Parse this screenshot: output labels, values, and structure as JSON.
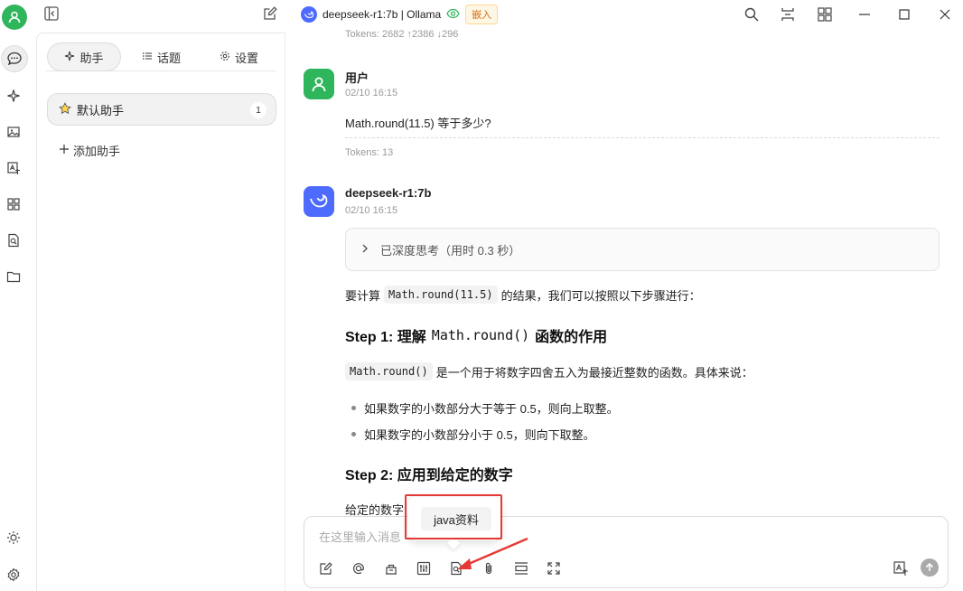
{
  "topbar": {
    "model_name": "deepseek-r1:7b | Ollama",
    "embed_tag": "嵌入"
  },
  "sidebar": {
    "tabs": [
      {
        "label": "助手"
      },
      {
        "label": "话题"
      },
      {
        "label": "设置"
      }
    ],
    "assistant": {
      "label": "默认助手",
      "count": "1"
    },
    "add_label": "添加助手"
  },
  "chat": {
    "prev_tokens": "Tokens: 2682 ↑2386 ↓296",
    "user": {
      "name": "用户",
      "time": "02/10 16:15",
      "text": "Math.round(11.5) 等于多少?",
      "tokens": "Tokens: 13"
    },
    "assistant": {
      "name": "deepseek-r1:7b",
      "time": "02/10 16:15",
      "thinking": "已深度思考（用时 0.3 秒）",
      "intro_pre": "要计算",
      "intro_code": "Math.round(11.5)",
      "intro_post": "的结果，我们可以按照以下步骤进行：",
      "step1_a": "Step 1: 理解",
      "step1_code": "Math.round()",
      "step1_b": "函数的作用",
      "desc_code": "Math.round()",
      "desc_text": "是一个用于将数字四舍五入为最接近整数的函数。具体来说：",
      "bullets": [
        "如果数字的小数部分大于等于 0.5，则向上取整。",
        "如果数字的小数部分小于 0.5，则向下取整。"
      ],
      "step2": "Step 2: 应用到给定的数字",
      "partial": "给定的数字"
    }
  },
  "input": {
    "placeholder": "在这里输入消息"
  },
  "popover": {
    "item": "java资料"
  },
  "colors": {
    "accent_green": "#2fb55b",
    "deepseek_blue": "#4d6bfe",
    "highlight_red": "#e53935"
  }
}
